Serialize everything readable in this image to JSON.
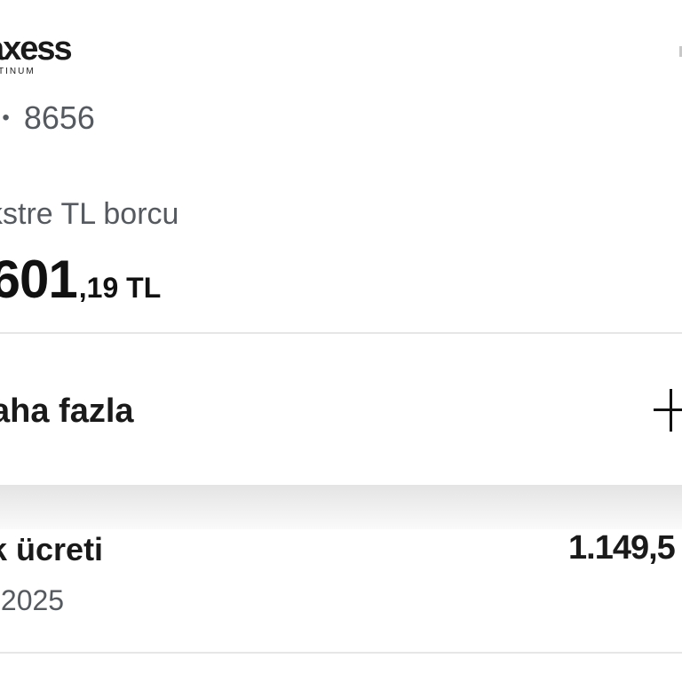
{
  "card": {
    "brand_name": "axess",
    "brand_tier": "TINUM",
    "number_masked": "•• ",
    "number_last4": "8656"
  },
  "statement": {
    "label": "kstre TL borcu",
    "amount_main": ".601",
    "amount_cents": ",19 TL"
  },
  "more": {
    "label": "aha fazla",
    "icon": "plus-icon"
  },
  "transaction": {
    "title": "k ücreti",
    "date": ".2025",
    "amount": "1.149,5"
  }
}
